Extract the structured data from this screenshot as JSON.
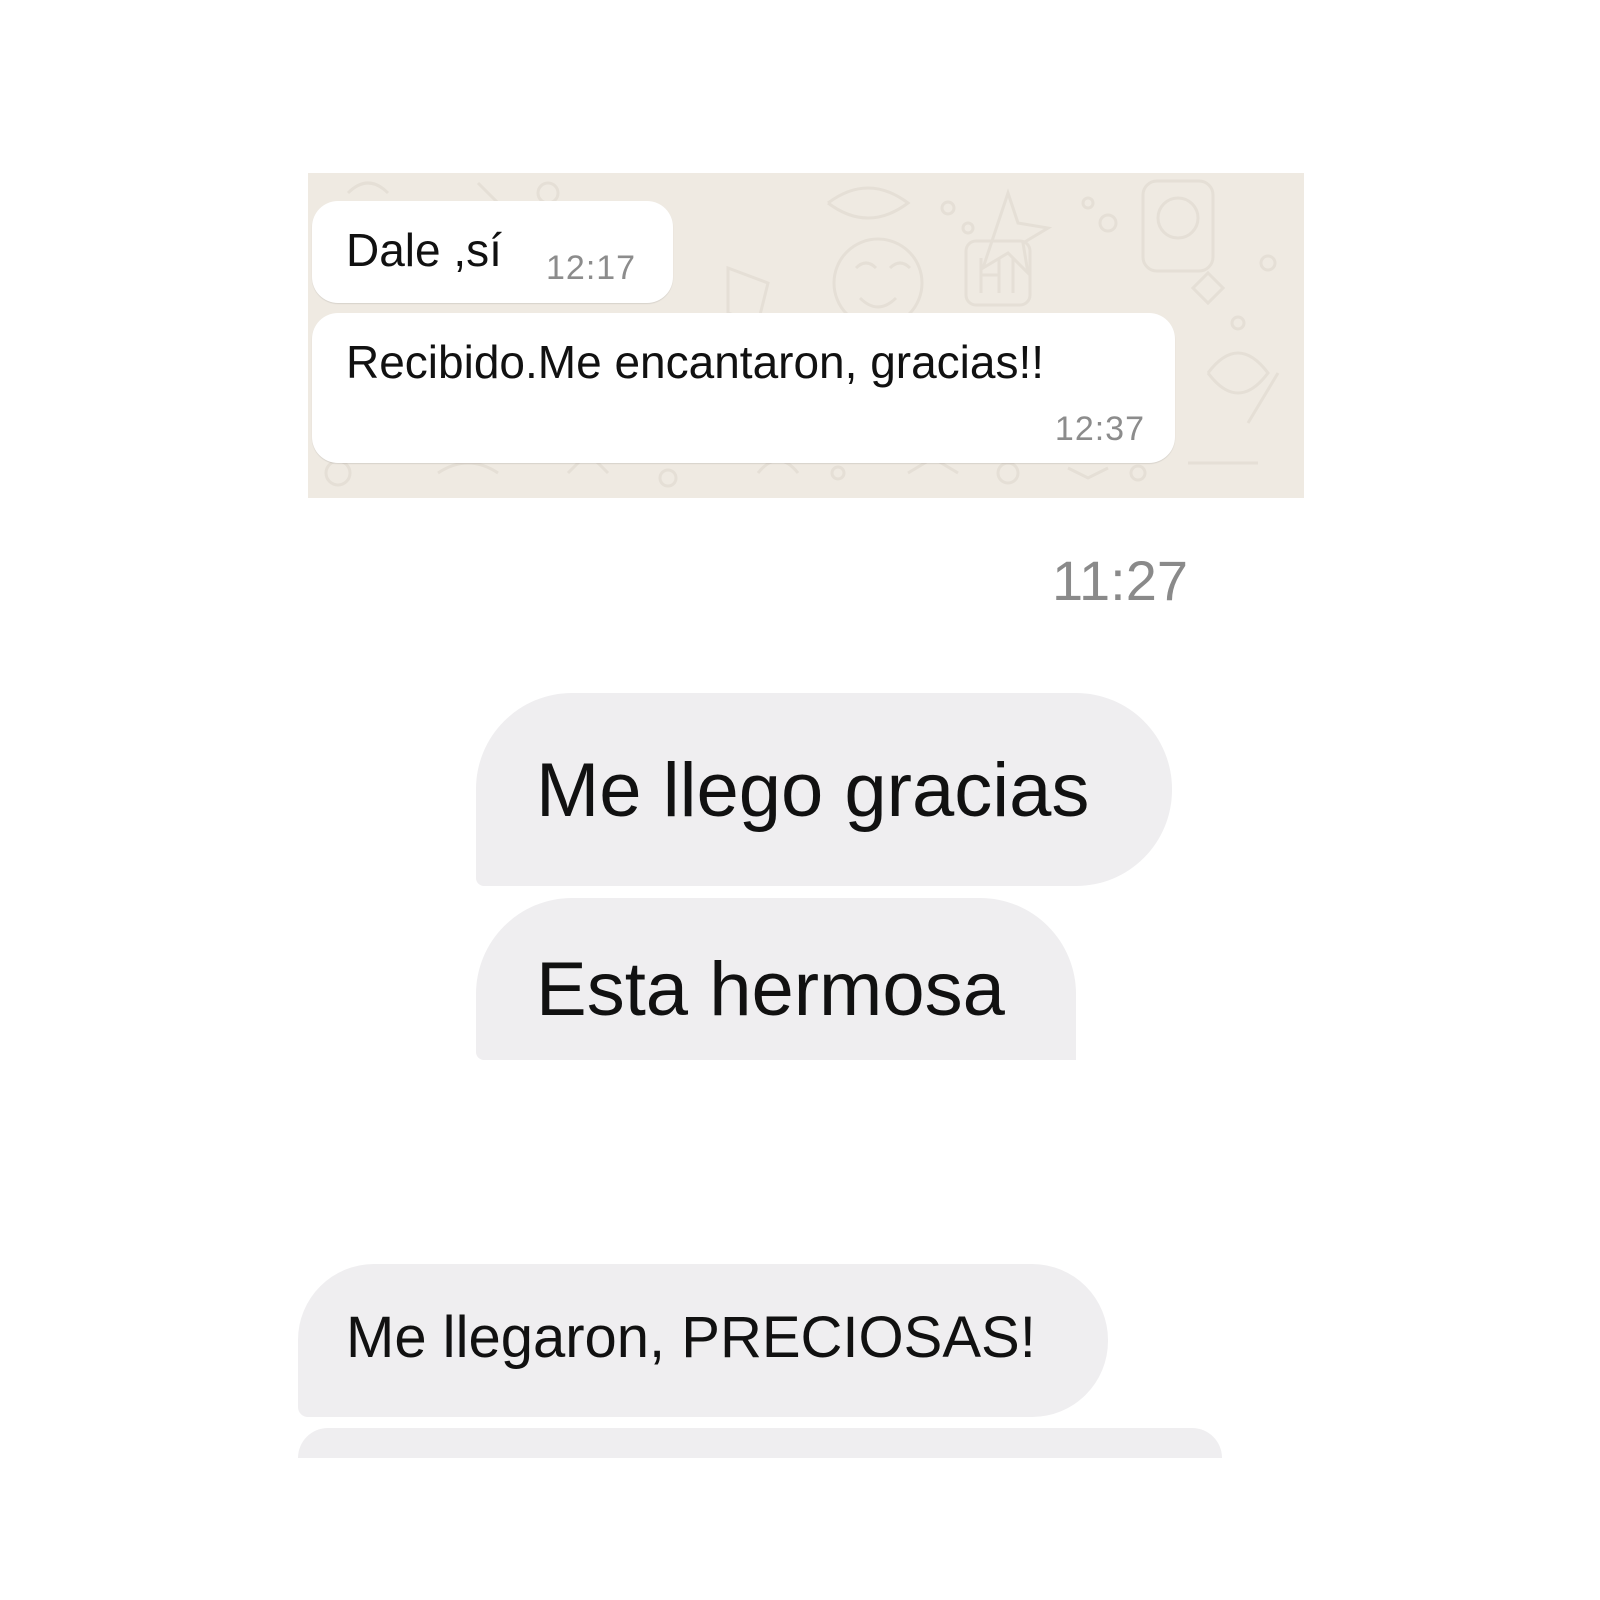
{
  "whatsapp": {
    "background_color": "#efeae2",
    "bubble_color": "#ffffff",
    "messages": [
      {
        "text": "Dale ,sí",
        "time": "12:17"
      },
      {
        "text": "Recibido.Me encantaron, gracias!!",
        "time": "12:37"
      }
    ]
  },
  "direct": {
    "timestamp": "11:27",
    "bubble_color": "#efeef0",
    "messages": [
      {
        "text": "Me llego gracias"
      },
      {
        "text": "Esta hermosa"
      }
    ]
  },
  "instagram": {
    "bubble_color": "#efeef0",
    "messages": [
      {
        "text": "Me llegaron, PRECIOSAS!"
      },
      {
        "text": ""
      }
    ]
  }
}
